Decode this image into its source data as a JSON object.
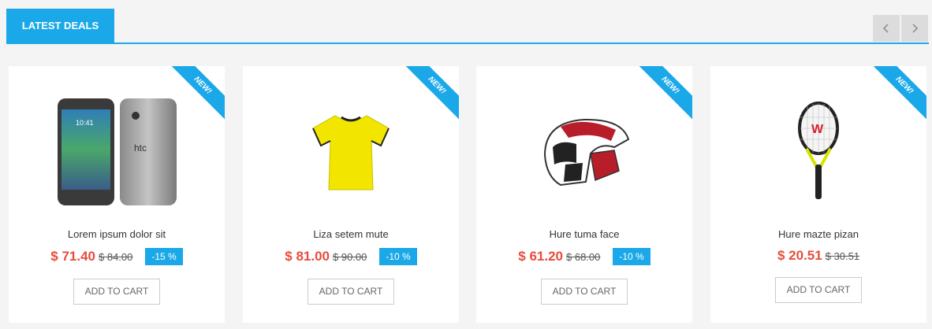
{
  "section": {
    "title": "LATEST DEALS"
  },
  "nav": {
    "prev_icon": "chevron-left-icon",
    "next_icon": "chevron-right-icon"
  },
  "products": [
    {
      "ribbon": "NEW!",
      "name": "Lorem ipsum dolor sit",
      "price": "$ 71.40",
      "old_price": "$ 84.00",
      "discount": "-15 %",
      "button": "ADD TO CART",
      "image": "smartphone-image"
    },
    {
      "ribbon": "NEW!",
      "name": "Liza setem mute",
      "price": "$ 81.00",
      "old_price": "$ 90.00",
      "discount": "-10 %",
      "button": "ADD TO CART",
      "image": "yellow-shirt-image"
    },
    {
      "ribbon": "NEW!",
      "name": "Hure tuma face",
      "price": "$ 61.20",
      "old_price": "$ 68.00",
      "discount": "-10 %",
      "button": "ADD TO CART",
      "image": "motocross-helmet-image"
    },
    {
      "ribbon": "NEW!",
      "name": "Hure mazte pizan",
      "price": "$ 20.51",
      "old_price": "$ 30.51",
      "discount": null,
      "button": "ADD TO CART",
      "image": "tennis-racket-image"
    }
  ],
  "colors": {
    "accent": "#1ba8e8",
    "price": "#e84c3d"
  }
}
